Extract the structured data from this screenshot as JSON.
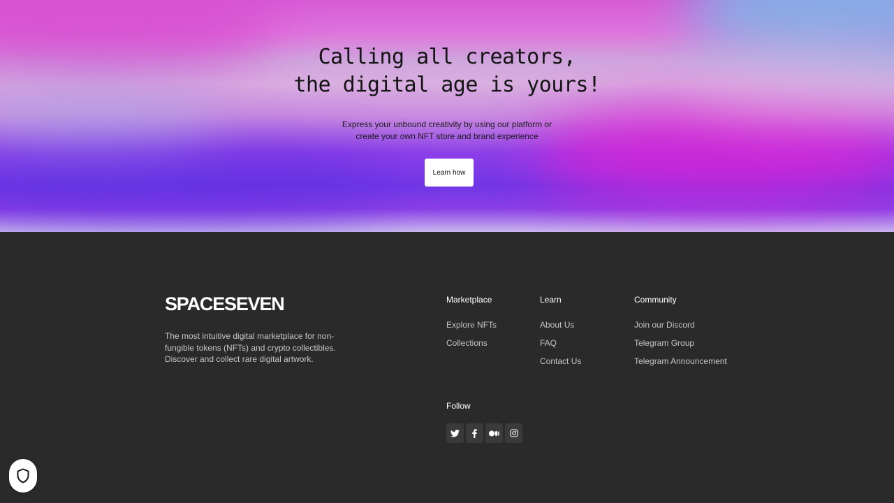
{
  "hero": {
    "title_line1": "Calling all creators,",
    "title_line2": "the digital age is yours!",
    "subtitle_line1": "Express your unbound creativity by using our platform or",
    "subtitle_line2": "create your own NFT store and brand experience",
    "cta_label": "Learn how"
  },
  "footer": {
    "brand": "SPACESEVEN",
    "description": "The most intuitive digital marketplace for non-fungible tokens (NFTs) and crypto collectibles. Discover and collect rare digital artwork.",
    "columns": [
      {
        "title": "Marketplace",
        "links": [
          "Explore NFTs",
          "Collections"
        ]
      },
      {
        "title": "Learn",
        "links": [
          "About Us",
          "FAQ",
          "Contact Us"
        ]
      },
      {
        "title": "Community",
        "links": [
          "Join our Discord",
          "Telegram Group",
          "Telegram Announcement"
        ]
      }
    ],
    "follow": {
      "title": "Follow",
      "icons": [
        "twitter-icon",
        "facebook-icon",
        "medium-icon",
        "instagram-icon"
      ]
    }
  },
  "privacy_widget": {
    "icon": "shield-icon"
  },
  "colors": {
    "footer_bg": "#2a2a2a",
    "hero_pink": "#e321d2",
    "hero_purple": "#7036e6",
    "hero_blue": "#7fb2e6"
  }
}
